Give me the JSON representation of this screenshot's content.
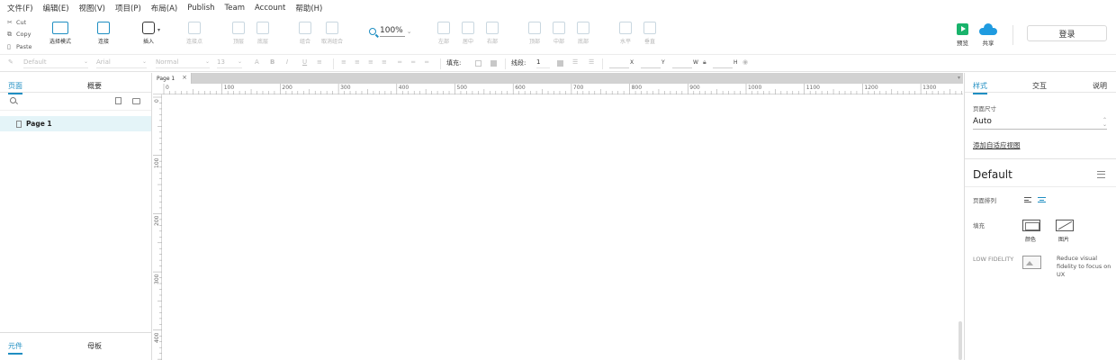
{
  "menu": [
    "文件(F)",
    "编辑(E)",
    "视图(V)",
    "项目(P)",
    "布局(A)",
    "Publish",
    "Team",
    "Account",
    "帮助(H)"
  ],
  "clipboard": [
    {
      "icon": "cut-icon",
      "label": "Cut"
    },
    {
      "icon": "copy-icon",
      "label": "Copy"
    },
    {
      "icon": "paste-icon",
      "label": "Paste"
    }
  ],
  "toolbar": {
    "select_mode": "选择模式",
    "connect": "连接",
    "insert": "插入",
    "connect_point": "连接点",
    "top_layer": "顶层",
    "bottom_layer": "底层",
    "group": "组合",
    "ungroup": "取消组合",
    "zoom": "100%",
    "align_left": "左部",
    "align_center": "居中",
    "align_right": "右部",
    "align_top": "顶部",
    "align_middle": "中部",
    "align_bottom": "底部",
    "horizontal": "水平",
    "vertical": "垂直",
    "preview": "预览",
    "share": "共享",
    "login": "登录"
  },
  "formatbar": {
    "style": "Default",
    "font": "Arial",
    "weight": "Normal",
    "size": "13",
    "fill_label": "填充:",
    "line_label": "线段:",
    "line_value": "1",
    "x": "X",
    "y": "Y",
    "w": "W",
    "h": "H"
  },
  "left_panel": {
    "tabs": [
      "页面",
      "概要"
    ],
    "pages": [
      "Page 1"
    ],
    "bottom_tabs": [
      "元件",
      "母板"
    ]
  },
  "canvas": {
    "tab": "Page 1",
    "h_ruler": [
      "0",
      "100",
      "200",
      "300",
      "400",
      "500",
      "600",
      "700",
      "800",
      "900",
      "1000",
      "1100",
      "1200",
      "1300"
    ],
    "v_ruler": [
      "0",
      "100",
      "200",
      "300",
      "400"
    ]
  },
  "right_panel": {
    "tabs": [
      "样式",
      "交互",
      "说明"
    ],
    "page_size_label": "页面尺寸",
    "page_size_value": "Auto",
    "adaptive_link": "添加自适应视图",
    "style_name": "Default",
    "page_align_label": "页面排列",
    "fill_label": "填充",
    "fill_color": "颜色",
    "fill_image": "图片",
    "low_fidelity_label": "LOW FIDELITY",
    "low_fidelity_desc": "Reduce visual fidelity to focus on UX"
  },
  "colors": {
    "accent": "#1f8ec2",
    "preview_green": "#19b36b",
    "share_blue": "#1f9be0",
    "selected_row": "#e4f4f8"
  }
}
